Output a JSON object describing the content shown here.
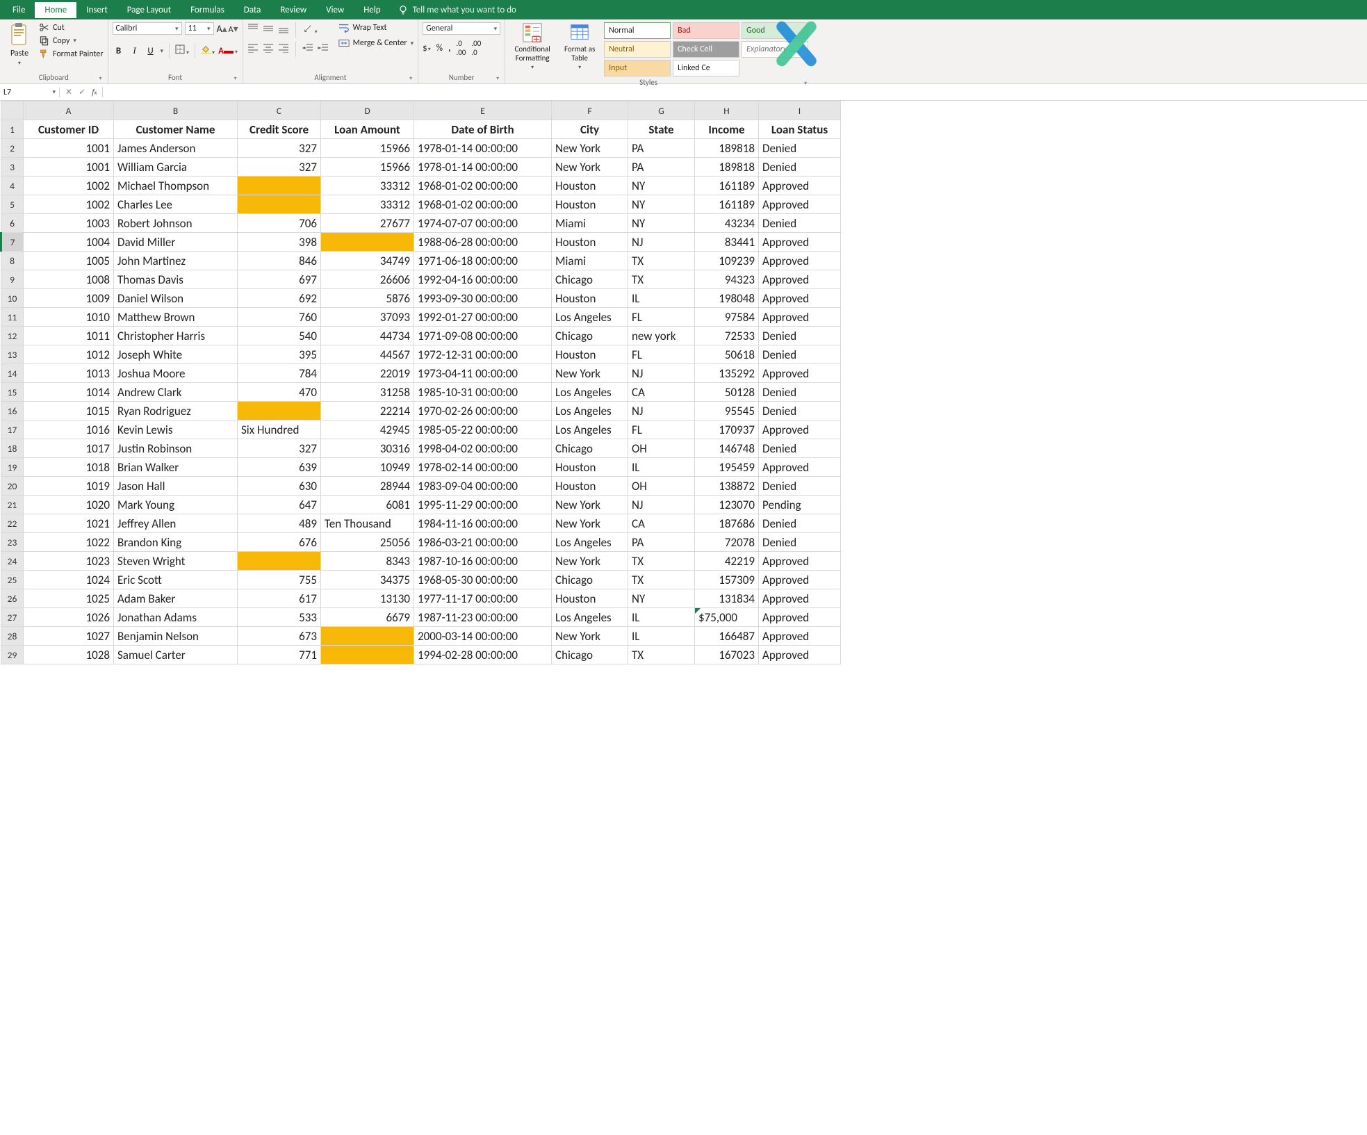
{
  "tabs": {
    "file": "File",
    "home": "Home",
    "insert": "Insert",
    "pageLayout": "Page Layout",
    "formulas": "Formulas",
    "data": "Data",
    "review": "Review",
    "view": "View",
    "help": "Help",
    "tell": "Tell me what you want to do"
  },
  "clipboard": {
    "paste": "Paste",
    "cut": "Cut",
    "copy": "Copy",
    "formatPainter": "Format Painter",
    "label": "Clipboard"
  },
  "font": {
    "name": "Calibri",
    "size": "11",
    "label": "Font"
  },
  "alignment": {
    "wrap": "Wrap Text",
    "merge": "Merge & Center",
    "label": "Alignment"
  },
  "number": {
    "general": "General",
    "label": "Number"
  },
  "cond": {
    "cf": "Conditional Formatting",
    "ft": "Format as Table"
  },
  "styles": {
    "normal": "Normal",
    "bad": "Bad",
    "good": "Good",
    "neutral": "Neutral",
    "check": "Check Cell",
    "expl": "Explanatory ...",
    "input": "Input",
    "linked": "Linked Ce",
    "label": "Styles"
  },
  "fbar": {
    "ref": "L7"
  },
  "columns": [
    "A",
    "B",
    "C",
    "D",
    "E",
    "F",
    "G",
    "H",
    "I"
  ],
  "headers": [
    "Customer ID",
    "Customer Name",
    "Credit Score",
    "Loan Amount",
    "Date of Birth",
    "City",
    "State",
    "Income",
    "Loan Status"
  ],
  "rows": [
    {
      "n": 2,
      "c": [
        "1001",
        "James Anderson",
        "327",
        "15966",
        "1978-01-14 00:00:00",
        "New York",
        "PA",
        "189818",
        "Denied"
      ]
    },
    {
      "n": 3,
      "c": [
        "1001",
        "William Garcia",
        "327",
        "15966",
        "1978-01-14 00:00:00",
        "New York",
        "PA",
        "189818",
        "Denied"
      ]
    },
    {
      "n": 4,
      "c": [
        "1002",
        "Michael Thompson",
        "",
        "33312",
        "1968-01-02 00:00:00",
        "Houston",
        "NY",
        "161189",
        "Approved"
      ],
      "hl": [
        2
      ]
    },
    {
      "n": 5,
      "c": [
        "1002",
        "Charles Lee",
        "",
        "33312",
        "1968-01-02 00:00:00",
        "Houston",
        "NY",
        "161189",
        "Approved"
      ],
      "hl": [
        2
      ]
    },
    {
      "n": 6,
      "c": [
        "1003",
        "Robert Johnson",
        "706",
        "27677",
        "1974-07-07 00:00:00",
        "Miami",
        "NY",
        "43234",
        "Denied"
      ]
    },
    {
      "n": 7,
      "c": [
        "1004",
        "David Miller",
        "398",
        "",
        "1988-06-28 00:00:00",
        "Houston",
        "NJ",
        "83441",
        "Approved"
      ],
      "hl": [
        3
      ],
      "active": true
    },
    {
      "n": 8,
      "c": [
        "1005",
        "John Martinez",
        "846",
        "34749",
        "1971-06-18 00:00:00",
        "Miami",
        "TX",
        "109239",
        "Approved"
      ]
    },
    {
      "n": 9,
      "c": [
        "1008",
        "Thomas Davis",
        "697",
        "26606",
        "1992-04-16 00:00:00",
        "Chicago",
        "TX",
        "94323",
        "Approved"
      ]
    },
    {
      "n": 10,
      "c": [
        "1009",
        "Daniel Wilson",
        "692",
        "5876",
        "1993-09-30 00:00:00",
        "Houston",
        "IL",
        "198048",
        "Approved"
      ]
    },
    {
      "n": 11,
      "c": [
        "1010",
        "Matthew Brown",
        "760",
        "37093",
        "1992-01-27 00:00:00",
        "Los Angeles",
        "FL",
        "97584",
        "Approved"
      ]
    },
    {
      "n": 12,
      "c": [
        "1011",
        "Christopher Harris",
        "540",
        "44734",
        "1971-09-08 00:00:00",
        "Chicago",
        "new york",
        "72533",
        "Denied"
      ]
    },
    {
      "n": 13,
      "c": [
        "1012",
        "Joseph White",
        "395",
        "44567",
        "1972-12-31 00:00:00",
        "Houston",
        "FL",
        "50618",
        "Denied"
      ]
    },
    {
      "n": 14,
      "c": [
        "1013",
        "Joshua Moore",
        "784",
        "22019",
        "1973-04-11 00:00:00",
        "New York",
        "NJ",
        "135292",
        "Approved"
      ]
    },
    {
      "n": 15,
      "c": [
        "1014",
        "Andrew Clark",
        "470",
        "31258",
        "1985-10-31 00:00:00",
        "Los Angeles",
        "CA",
        "50128",
        "Denied"
      ]
    },
    {
      "n": 16,
      "c": [
        "1015",
        "Ryan Rodriguez",
        "",
        "22214",
        "1970-02-26 00:00:00",
        "Los Angeles",
        "NJ",
        "95545",
        "Denied"
      ],
      "hl": [
        2
      ]
    },
    {
      "n": 17,
      "c": [
        "1016",
        "Kevin Lewis",
        "Six Hundred",
        "42945",
        "1985-05-22 00:00:00",
        "Los Angeles",
        "FL",
        "170937",
        "Approved"
      ],
      "txt": [
        2
      ]
    },
    {
      "n": 18,
      "c": [
        "1017",
        "Justin Robinson",
        "327",
        "30316",
        "1998-04-02 00:00:00",
        "Chicago",
        "OH",
        "146748",
        "Denied"
      ]
    },
    {
      "n": 19,
      "c": [
        "1018",
        "Brian Walker",
        "639",
        "10949",
        "1978-02-14 00:00:00",
        "Houston",
        "IL",
        "195459",
        "Approved"
      ]
    },
    {
      "n": 20,
      "c": [
        "1019",
        "Jason Hall",
        "630",
        "28944",
        "1983-09-04 00:00:00",
        "Houston",
        "OH",
        "138872",
        "Denied"
      ]
    },
    {
      "n": 21,
      "c": [
        "1020",
        "Mark Young",
        "647",
        "6081",
        "1995-11-29 00:00:00",
        "New York",
        "NJ",
        "123070",
        "Pending"
      ]
    },
    {
      "n": 22,
      "c": [
        "1021",
        "Jeffrey Allen",
        "489",
        "Ten Thousand",
        "1984-11-16 00:00:00",
        "New York",
        "CA",
        "187686",
        "Denied"
      ],
      "txt": [
        3
      ]
    },
    {
      "n": 23,
      "c": [
        "1022",
        "Brandon King",
        "676",
        "25056",
        "1986-03-21 00:00:00",
        "Los Angeles",
        "PA",
        "72078",
        "Denied"
      ]
    },
    {
      "n": 24,
      "c": [
        "1023",
        "Steven Wright",
        "",
        "8343",
        "1987-10-16 00:00:00",
        "New York",
        "TX",
        "42219",
        "Approved"
      ],
      "hl": [
        2
      ]
    },
    {
      "n": 25,
      "c": [
        "1024",
        "Eric Scott",
        "755",
        "34375",
        "1968-05-30 00:00:00",
        "Chicago",
        "TX",
        "157309",
        "Approved"
      ]
    },
    {
      "n": 26,
      "c": [
        "1025",
        "Adam Baker",
        "617",
        "13130",
        "1977-11-17 00:00:00",
        "Houston",
        "NY",
        "131834",
        "Approved"
      ]
    },
    {
      "n": 27,
      "c": [
        "1026",
        "Jonathan Adams",
        "533",
        "6679",
        "1987-11-23 00:00:00",
        "Los Angeles",
        "IL",
        "$75,000",
        "Approved"
      ],
      "err": [
        7
      ],
      "txt": [
        7
      ]
    },
    {
      "n": 28,
      "c": [
        "1027",
        "Benjamin Nelson",
        "673",
        "",
        "2000-03-14 00:00:00",
        "New York",
        "IL",
        "166487",
        "Approved"
      ],
      "hl": [
        3
      ]
    },
    {
      "n": 29,
      "c": [
        "1028",
        "Samuel Carter",
        "771",
        "",
        "1994-02-28 00:00:00",
        "Chicago",
        "TX",
        "167023",
        "Approved"
      ],
      "hl": [
        3
      ]
    }
  ],
  "col_align": [
    "r",
    "l",
    "r",
    "r",
    "l",
    "l",
    "l",
    "r",
    "l"
  ]
}
